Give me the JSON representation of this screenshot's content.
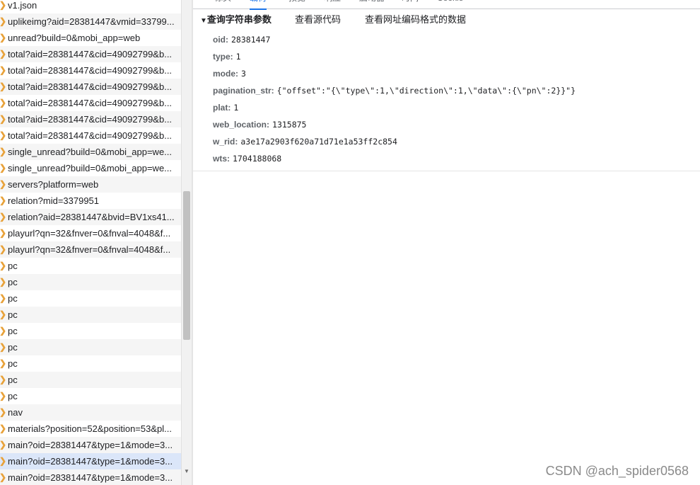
{
  "requests": [
    {
      "name": "v1.json"
    },
    {
      "name": "uplikeimg?aid=28381447&vmid=33799..."
    },
    {
      "name": "unread?build=0&mobi_app=web"
    },
    {
      "name": "total?aid=28381447&cid=49092799&b..."
    },
    {
      "name": "total?aid=28381447&cid=49092799&b..."
    },
    {
      "name": "total?aid=28381447&cid=49092799&b..."
    },
    {
      "name": "total?aid=28381447&cid=49092799&b..."
    },
    {
      "name": "total?aid=28381447&cid=49092799&b..."
    },
    {
      "name": "total?aid=28381447&cid=49092799&b..."
    },
    {
      "name": "single_unread?build=0&mobi_app=we..."
    },
    {
      "name": "single_unread?build=0&mobi_app=we..."
    },
    {
      "name": "servers?platform=web"
    },
    {
      "name": "relation?mid=3379951"
    },
    {
      "name": "relation?aid=28381447&bvid=BV1xs41..."
    },
    {
      "name": "playurl?qn=32&fnver=0&fnval=4048&f..."
    },
    {
      "name": "playurl?qn=32&fnver=0&fnval=4048&f..."
    },
    {
      "name": "pc"
    },
    {
      "name": "pc"
    },
    {
      "name": "pc"
    },
    {
      "name": "pc"
    },
    {
      "name": "pc"
    },
    {
      "name": "pc"
    },
    {
      "name": "pc"
    },
    {
      "name": "pc"
    },
    {
      "name": "pc"
    },
    {
      "name": "nav"
    },
    {
      "name": "materials?position=52&position=53&pl..."
    },
    {
      "name": "main?oid=28381447&type=1&mode=3..."
    },
    {
      "name": "main?oid=28381447&type=1&mode=3...",
      "selected": true
    },
    {
      "name": "main?oid=28381447&type=1&mode=3..."
    }
  ],
  "tabs": [
    "标头",
    "载荷",
    "预览",
    "响应",
    "启动器",
    "时间",
    "Cookie"
  ],
  "active_tab": "载荷",
  "payload": {
    "section_title": "查询字符串参数",
    "view_source": "查看源代码",
    "view_url_encoded": "查看网址编码格式的数据",
    "params": [
      {
        "key": "oid:",
        "value": "28381447"
      },
      {
        "key": "type:",
        "value": "1"
      },
      {
        "key": "mode:",
        "value": "3"
      },
      {
        "key": "pagination_str:",
        "value": "{\"offset\":\"{\\\"type\\\":1,\\\"direction\\\":1,\\\"data\\\":{\\\"pn\\\":2}}\"}"
      },
      {
        "key": "plat:",
        "value": "1"
      },
      {
        "key": "web_location:",
        "value": "1315875"
      },
      {
        "key": "w_rid:",
        "value": "a3e17a2903f620a71d71e1a53ff2c854"
      },
      {
        "key": "wts:",
        "value": "1704188068"
      }
    ]
  },
  "watermark": "CSDN @ach_spider0568",
  "colors": {
    "accent": "#1a73e8",
    "selected_row": "#dbe6f9",
    "icon": "#e8a23a"
  }
}
